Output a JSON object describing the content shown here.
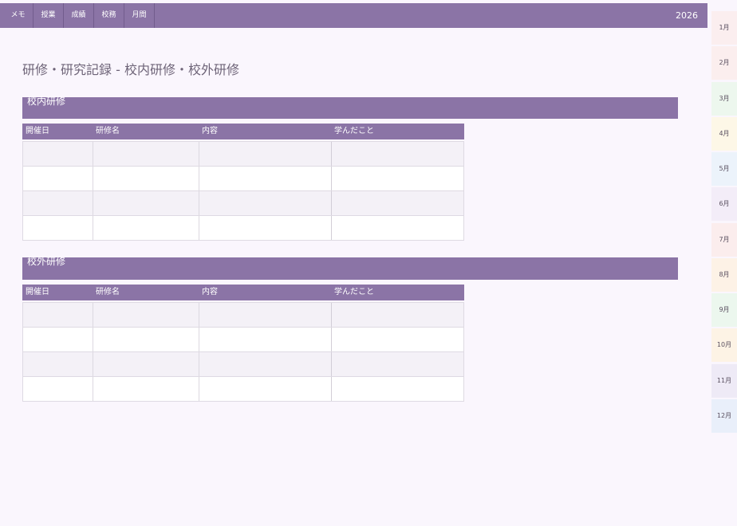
{
  "theme": {
    "accent": "#8b74a6",
    "background": "#faf6fd",
    "title_color": "#6e6478"
  },
  "nav": {
    "tabs": [
      {
        "label": "メモ"
      },
      {
        "label": "授業"
      },
      {
        "label": "成績"
      },
      {
        "label": "校務"
      },
      {
        "label": "月間"
      }
    ],
    "year": "2026"
  },
  "page": {
    "title": "研修・研究記録 - 校内研修・校外研修"
  },
  "sections": [
    {
      "title": "校内研修",
      "columns": [
        "開催日",
        "研修名",
        "内容",
        "学んだこと"
      ],
      "rows": [
        [
          "",
          "",
          "",
          ""
        ],
        [
          "",
          "",
          "",
          ""
        ],
        [
          "",
          "",
          "",
          ""
        ],
        [
          "",
          "",
          "",
          ""
        ]
      ]
    },
    {
      "title": "校外研修",
      "columns": [
        "開催日",
        "研修名",
        "内容",
        "学んだこと"
      ],
      "rows": [
        [
          "",
          "",
          "",
          ""
        ],
        [
          "",
          "",
          "",
          ""
        ],
        [
          "",
          "",
          "",
          ""
        ],
        [
          "",
          "",
          "",
          ""
        ]
      ]
    }
  ],
  "months": [
    {
      "label": "1月",
      "color": "#fbeeef"
    },
    {
      "label": "2月",
      "color": "#fbeeee"
    },
    {
      "label": "3月",
      "color": "#edf7ee"
    },
    {
      "label": "4月",
      "color": "#fdf7e7"
    },
    {
      "label": "5月",
      "color": "#ecf3fb"
    },
    {
      "label": "6月",
      "color": "#f3edf8"
    },
    {
      "label": "7月",
      "color": "#fbeded"
    },
    {
      "label": "8月",
      "color": "#fdf2e6"
    },
    {
      "label": "9月",
      "color": "#ecf7ee"
    },
    {
      "label": "10月",
      "color": "#fdf3e5"
    },
    {
      "label": "11月",
      "color": "#eeeaf6"
    },
    {
      "label": "12月",
      "color": "#e9effa"
    }
  ]
}
